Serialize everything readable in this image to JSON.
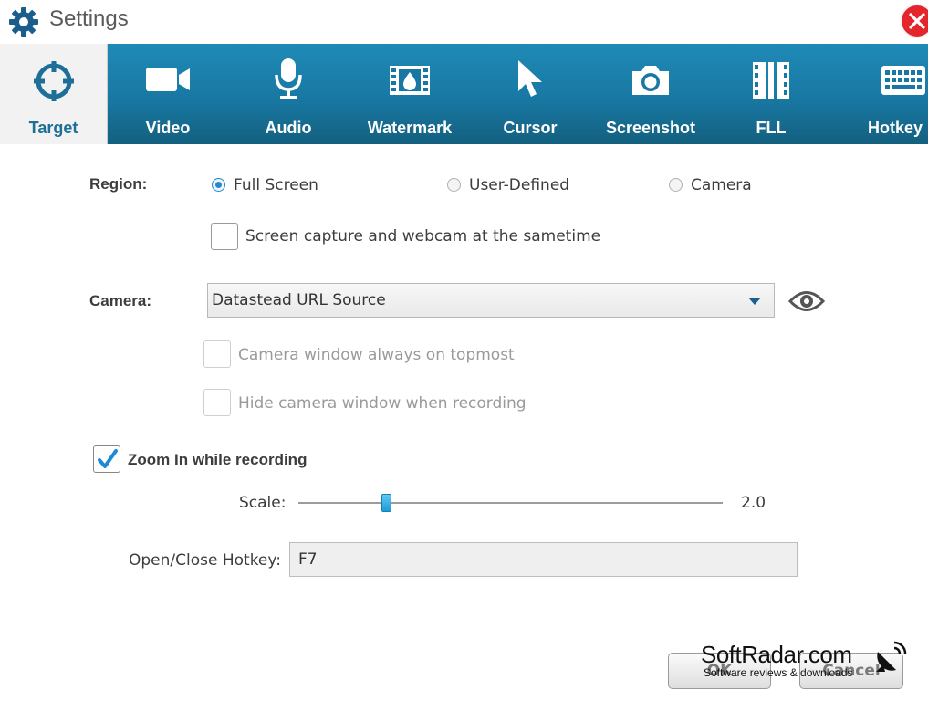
{
  "window": {
    "title": "Settings",
    "icon": "gear-icon",
    "close_icon": "close-icon"
  },
  "tabs": [
    {
      "label": "Target",
      "icon": "crosshair-icon",
      "active": true
    },
    {
      "label": "Video",
      "icon": "video-camera-icon"
    },
    {
      "label": "Audio",
      "icon": "microphone-icon"
    },
    {
      "label": "Watermark",
      "icon": "watermark-icon"
    },
    {
      "label": "Cursor",
      "icon": "cursor-icon"
    },
    {
      "label": "Screenshot",
      "icon": "camera-icon"
    },
    {
      "label": "FLL",
      "icon": "film-icon"
    },
    {
      "label": "Hotkey",
      "icon": "keyboard-icon"
    }
  ],
  "region": {
    "label": "Region:",
    "options": [
      "Full Screen",
      "User-Defined",
      "Camera"
    ],
    "selected": "Full Screen"
  },
  "sametime_checkbox": {
    "label": "Screen capture and webcam at the sametime",
    "checked": false
  },
  "camera": {
    "label": "Camera:",
    "selected": "Datastead URL Source",
    "preview_icon": "eye-icon"
  },
  "camera_topmost": {
    "label": "Camera window always on topmost",
    "checked": false,
    "enabled": false
  },
  "camera_hide": {
    "label": "Hide camera window when recording",
    "checked": false,
    "enabled": false
  },
  "zoom": {
    "label": "Zoom In while recording",
    "checked": true
  },
  "scale": {
    "label": "Scale:",
    "value": "2.0",
    "slider_fraction": 0.2
  },
  "hotkey": {
    "label": "Open/Close Hotkey:",
    "value": "F7"
  },
  "buttons": {
    "ok": "OK",
    "cancel": "Cancel"
  },
  "watermark": {
    "name": "SoftRadar.com",
    "tagline": "Software reviews & downloads"
  },
  "colors": {
    "accent": "#1c8ad6",
    "tab_bar": "#1878a3",
    "close": "#e4262c"
  }
}
